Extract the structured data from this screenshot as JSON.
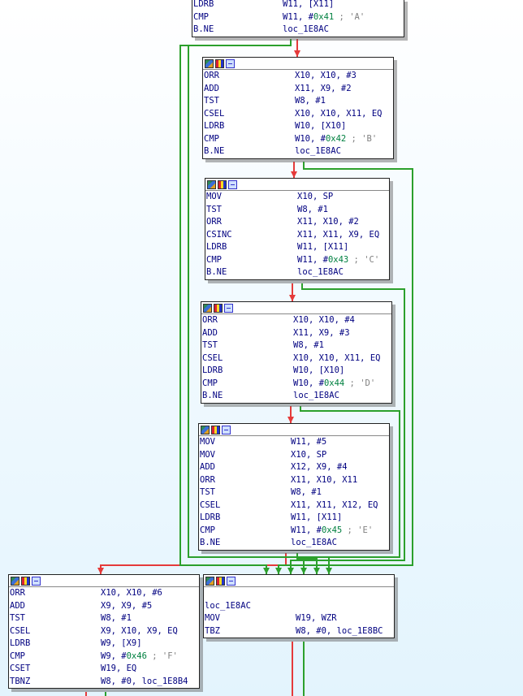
{
  "blocks": [
    {
      "id": "b0",
      "rows": [
        {
          "m": "LDRB",
          "o": "W11, [X11]"
        },
        {
          "m": "CMP",
          "o": "W11, #",
          "n": "0x41",
          "c": " ; 'A'"
        },
        {
          "m": "B.NE",
          "o": "loc_1E8AC"
        }
      ]
    },
    {
      "id": "b1",
      "rows": [
        {
          "m": "ORR",
          "o": "X10, X10, #3"
        },
        {
          "m": "ADD",
          "o": "X11, X9, #2"
        },
        {
          "m": "TST",
          "o": "W8, #1"
        },
        {
          "m": "CSEL",
          "o": "X10, X10, X11, EQ"
        },
        {
          "m": "LDRB",
          "o": "W10, [X10]"
        },
        {
          "m": "CMP",
          "o": "W10, #",
          "n": "0x42",
          "c": " ; 'B'"
        },
        {
          "m": "B.NE",
          "o": "loc_1E8AC"
        }
      ]
    },
    {
      "id": "b2",
      "rows": [
        {
          "m": "MOV",
          "o": "X10, SP"
        },
        {
          "m": "TST",
          "o": "W8, #1"
        },
        {
          "m": "ORR",
          "o": "X11, X10, #2"
        },
        {
          "m": "CSINC",
          "o": "X11, X11, X9, EQ"
        },
        {
          "m": "LDRB",
          "o": "W11, [X11]"
        },
        {
          "m": "CMP",
          "o": "W11, #",
          "n": "0x43",
          "c": " ; 'C'"
        },
        {
          "m": "B.NE",
          "o": "loc_1E8AC"
        }
      ]
    },
    {
      "id": "b3",
      "rows": [
        {
          "m": "ORR",
          "o": "X10, X10, #4"
        },
        {
          "m": "ADD",
          "o": "X11, X9, #3"
        },
        {
          "m": "TST",
          "o": "W8, #1"
        },
        {
          "m": "CSEL",
          "o": "X10, X10, X11, EQ"
        },
        {
          "m": "LDRB",
          "o": "W10, [X10]"
        },
        {
          "m": "CMP",
          "o": "W10, #",
          "n": "0x44",
          "c": " ; 'D'"
        },
        {
          "m": "B.NE",
          "o": "loc_1E8AC"
        }
      ]
    },
    {
      "id": "b4",
      "rows": [
        {
          "m": "MOV",
          "o": "W11, #5"
        },
        {
          "m": "MOV",
          "o": "X10, SP"
        },
        {
          "m": "ADD",
          "o": "X12, X9, #4"
        },
        {
          "m": "ORR",
          "o": "X11, X10, X11"
        },
        {
          "m": "TST",
          "o": "W8, #1"
        },
        {
          "m": "CSEL",
          "o": "X11, X11, X12, EQ"
        },
        {
          "m": "LDRB",
          "o": "W11, [X11]"
        },
        {
          "m": "CMP",
          "o": "W11, #",
          "n": "0x45",
          "c": " ; 'E'"
        },
        {
          "m": "B.NE",
          "o": "loc_1E8AC"
        }
      ]
    },
    {
      "id": "b5",
      "rows": [
        {
          "m": "ORR",
          "o": "X10, X10, #6"
        },
        {
          "m": "ADD",
          "o": "X9, X9, #5"
        },
        {
          "m": "TST",
          "o": "W8, #1"
        },
        {
          "m": "CSEL",
          "o": "X9, X10, X9, EQ"
        },
        {
          "m": "LDRB",
          "o": "W9, [X9]"
        },
        {
          "m": "CMP",
          "o": "W9, #",
          "n": "0x46",
          "c": " ; 'F'"
        },
        {
          "m": "CSET",
          "o": "W19, EQ"
        },
        {
          "m": "TBNZ",
          "o": "W8, #0, loc_1E8B4"
        }
      ]
    },
    {
      "id": "b6",
      "label": "loc_1E8AC",
      "rows": [
        {
          "m": "MOV",
          "o": "W19, WZR"
        },
        {
          "m": "TBZ",
          "o": "W8, #0, loc_1E8BC"
        }
      ]
    }
  ],
  "colors": {
    "true_edge": "#2ca02c",
    "false_edge": "#e53a3a",
    "mnemonic": "#000080",
    "number": "#008040",
    "comment": "#808080"
  },
  "icons": [
    "graph-overview-icon",
    "color-icon",
    "group-icon"
  ]
}
